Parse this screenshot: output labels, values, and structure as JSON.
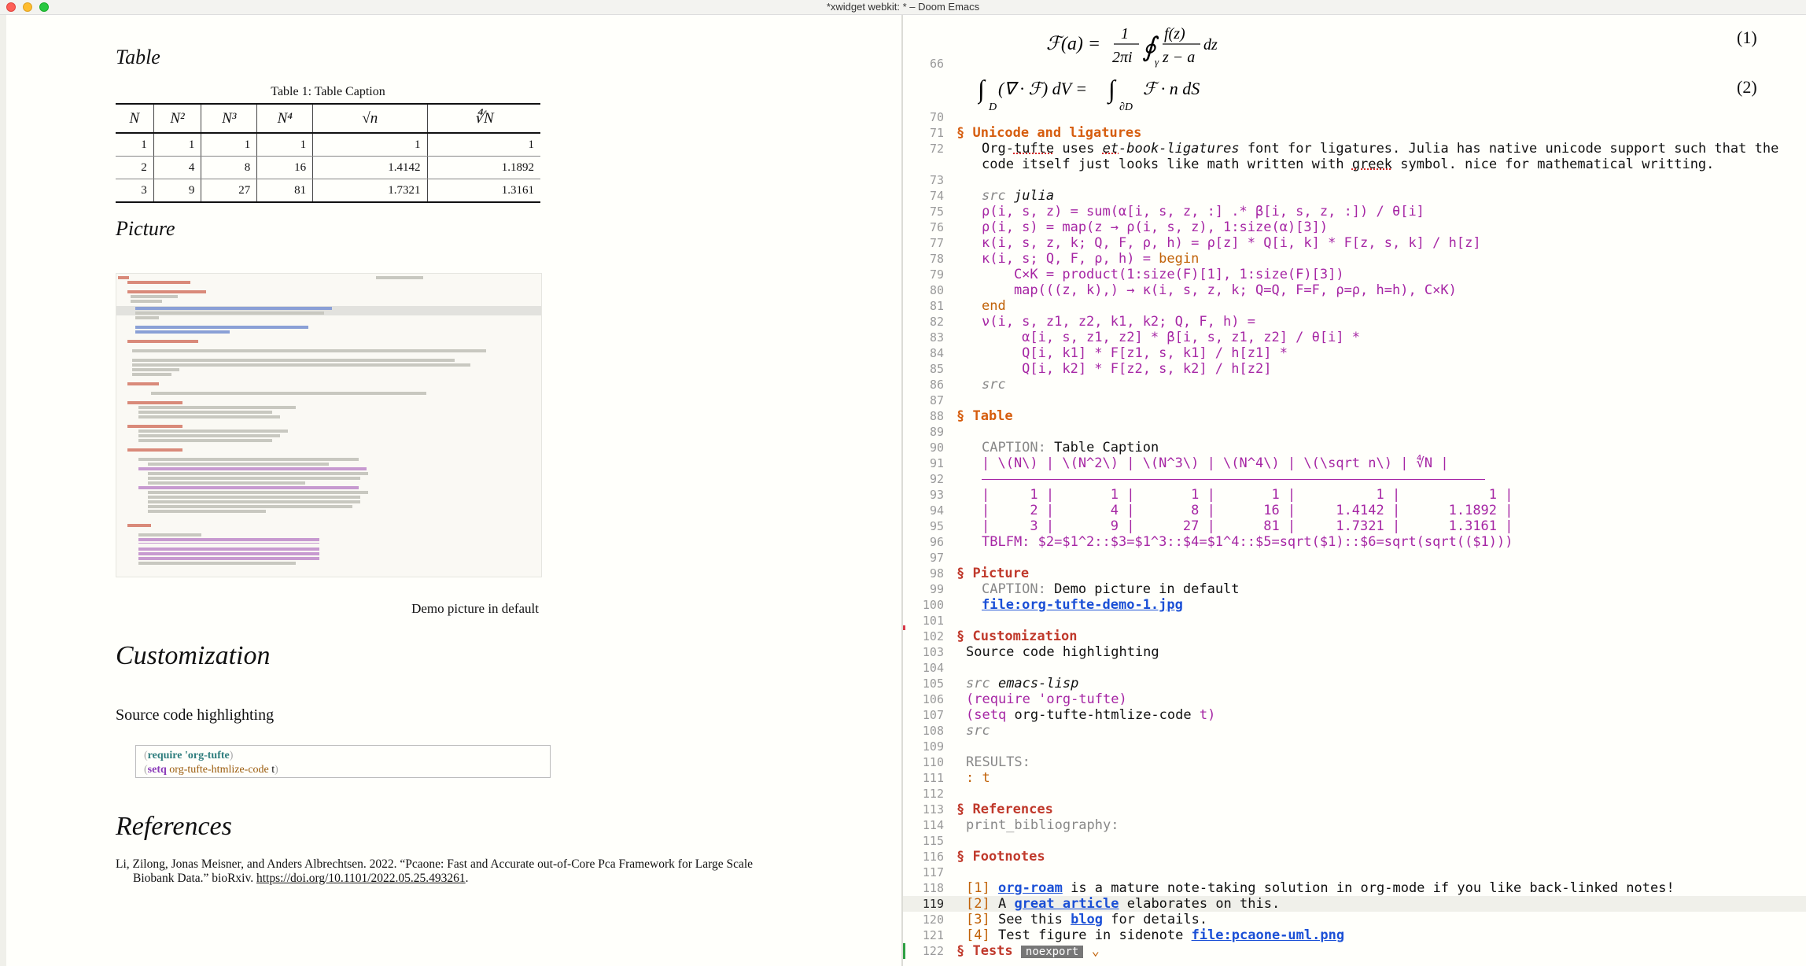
{
  "window": {
    "title": "*xwidget webkit: * – Doom Emacs"
  },
  "preview": {
    "table_heading": "Table",
    "table_caption": "Table 1: Table Caption",
    "table_headers": [
      "N",
      "N²",
      "N³",
      "N⁴",
      "√n",
      "∜N"
    ],
    "table_rows": [
      [
        "1",
        "1",
        "1",
        "1",
        "1",
        "1"
      ],
      [
        "2",
        "4",
        "8",
        "16",
        "1.4142",
        "1.1892"
      ],
      [
        "3",
        "9",
        "27",
        "81",
        "1.7321",
        "1.3161"
      ]
    ],
    "picture_heading": "Picture",
    "picture_caption": "Demo picture in default",
    "customization_heading": "Customization",
    "source_text": "Source code highlighting",
    "code_line1": {
      "open": "(",
      "kw": "require",
      "arg": "'org-tufte",
      "close": ")"
    },
    "code_line2": {
      "open": "(",
      "kw": "setq",
      "arg": "org-tufte-htmlize-code",
      "val": "t",
      "close": ")"
    },
    "references_heading": "References",
    "reference_text_1": "Li, Zilong, Jonas Meisner, and Anders Albrechtsen. 2022. “Pcaone: Fast and Accurate out-of-Core Pca Framework for Large Scale",
    "reference_text_2": "Biobank Data.” bioRxiv. ",
    "reference_link": "https://doi.org/10.1101/2022.05.25.493261",
    "reference_end": "."
  },
  "editor": {
    "eq1_num": "(1)",
    "eq2_num": "(2)",
    "lines": {
      "l66": "66",
      "l70": "70",
      "l71": "71",
      "t71": "§ Unicode and ligatures",
      "l72": "72",
      "t72a": "Org-",
      "t72b": "tufte",
      "t72c": " uses ",
      "t72d": "et",
      "t72e": "-book-ligatures",
      "t72f": " font for ligatures. Julia has native unicode support such that the",
      "t72g": "code itself just looks like math written with ",
      "t72h": "greek",
      "t72i": " symbol. nice for mathematical writting.",
      "l73": "73",
      "l74": "74",
      "t74a": "src",
      "t74b": " julia",
      "l75": "75",
      "t75": "ρ(i, s, z) = sum(α[i, s, z, :] .* β[i, s, z, :]) / θ[i]",
      "l76": "76",
      "t76": "ρ(i, s) = map(z → ρ(i, s, z), 1:size(α)[3])",
      "l77": "77",
      "t77": "κ(i, s, z, k; Q, F, ρ, h) = ρ[z] * Q[i, k] * F[z, s, k] / h[z]",
      "l78": "78",
      "t78a": "κ(i, s; Q, F, ρ, h) = ",
      "t78b": "begin",
      "l79": "79",
      "t79": "    C×K = product(1:size(F)[1], 1:size(F)[3])",
      "l80": "80",
      "t80": "    map(((z, k),) → κ(i, s, z, k; Q=Q, F=F, ρ=ρ, h=h), C×K)",
      "l81": "81",
      "t81": "end",
      "l82": "82",
      "t82": "ν(i, s, z1, z2, k1, k2; Q, F, h) =",
      "l83": "83",
      "t83": "     α[i, s, z1, z2] * β[i, s, z1, z2] / θ[i] *",
      "l84": "84",
      "t84": "     Q[i, k1] * F[z1, s, k1] / h[z1] *",
      "l85": "85",
      "t85": "     Q[i, k2] * F[z2, s, k2] / h[z2]",
      "l86": "86",
      "t86": "src",
      "l87": "87",
      "l88": "88",
      "t88": "§ Table",
      "l89": "89",
      "l90": "90",
      "t90a": "CAPTION:",
      "t90b": " Table Caption",
      "l91": "91",
      "t91": "| \\(N\\) | \\(N^2\\) | \\(N^3\\) | \\(N^4\\) | \\(\\sqrt n\\) | ∜N |",
      "l92": "92",
      "l93": "93",
      "t93": "|     1 |       1 |       1 |       1 |          1 |           1 |",
      "l94": "94",
      "t94": "|     2 |       4 |       8 |      16 |     1.4142 |      1.1892 |",
      "l95": "95",
      "t95": "|     3 |       9 |      27 |      81 |     1.7321 |      1.3161 |",
      "l96": "96",
      "t96": "TBLFM: $2=$1^2::$3=$1^3::$4=$1^4::$5=sqrt($1)::$6=sqrt(sqrt(($1)))",
      "l97": "97",
      "l98": "98",
      "t98": "§ Picture",
      "l99": "99",
      "t99a": "CAPTION:",
      "t99b": " Demo picture in default",
      "l100": "100",
      "t100": "file:org-tufte-demo-1.jpg",
      "l101": "101",
      "l102": "102",
      "t102": "§ Customization",
      "l103": "103",
      "t103": "Source code highlighting",
      "l104": "104",
      "l105": "105",
      "t105a": "src",
      "t105b": " emacs-lisp",
      "l106": "106",
      "t106a": "(",
      "t106b": "require",
      "t106c": " 'org-tufte",
      "t106d": ")",
      "l107": "107",
      "t107a": "(",
      "t107b": "setq",
      "t107c": " org-tufte-htmlize-code ",
      "t107d": "t",
      "t107e": ")",
      "l108": "108",
      "t108": "src",
      "l109": "109",
      "l110": "110",
      "t110": "RESULTS:",
      "l111": "111",
      "t111": ": t",
      "l112": "112",
      "l113": "113",
      "t113": "§ References",
      "l114": "114",
      "t114": "print_bibliography:",
      "l115": "115",
      "l116": "116",
      "t116": "§ Footnotes",
      "l117": "117",
      "l118": "118",
      "t118a": "[1] ",
      "t118b": "org-roam",
      "t118c": " is a mature note-taking solution in org-mode if you like back-linked notes!",
      "l119": "119",
      "t119a": "[2] ",
      "t119b": "A ",
      "t119c": "great article",
      "t119d": " elaborates on this.",
      "l120": "120",
      "t120a": "[3] ",
      "t120b": "See this ",
      "t120c": "blog",
      "t120d": " for details.",
      "l121": "121",
      "t121a": "[4] ",
      "t121b": "Test figure in sidenote ",
      "t121c": "file:pcaone-uml.png",
      "l122": "122",
      "t122": "§ Tests",
      "t122tag": "noexport",
      "t122fold": "⌄"
    }
  },
  "colors": {
    "heading": "#d65d0e",
    "link": "#1a4fd6",
    "table": "#a626a4",
    "keyword": "#a626a4"
  }
}
